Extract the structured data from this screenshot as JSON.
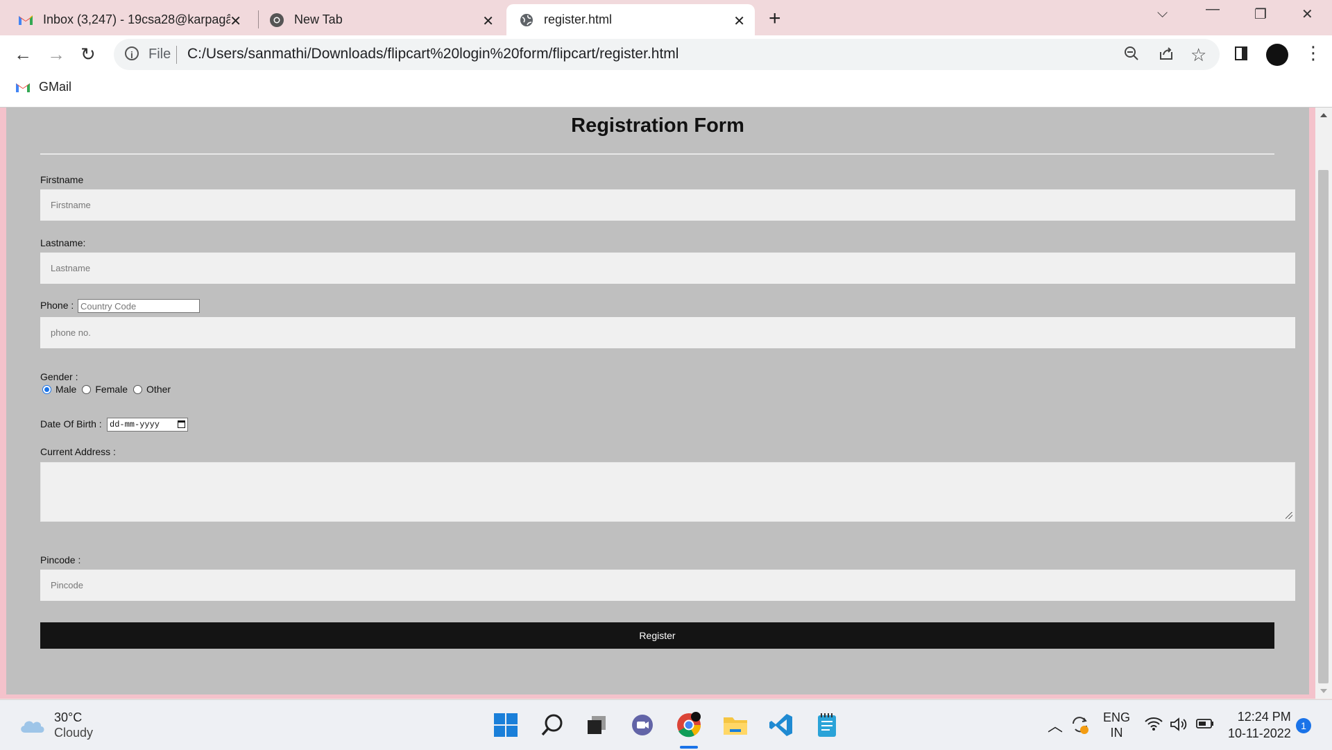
{
  "browser": {
    "tabs": [
      {
        "title": "Inbox (3,247) - 19csa28@karpagâ"
      },
      {
        "title": "New Tab"
      },
      {
        "title": "register.html"
      }
    ],
    "address_bar": {
      "scheme_label": "File",
      "url": "C:/Users/sanmathi/Downloads/flipcart%20login%20form/flipcart/register.html"
    },
    "bookmarks": [
      {
        "label": "GMail"
      }
    ]
  },
  "form": {
    "title": "Registration Form",
    "firstname": {
      "label": "Firstname",
      "placeholder": "Firstname",
      "value": ""
    },
    "lastname": {
      "label": "Lastname:",
      "placeholder": "Lastname",
      "value": ""
    },
    "phone": {
      "label": "Phone :",
      "country_code_placeholder": "Country Code",
      "placeholder": "phone no.",
      "value": ""
    },
    "gender": {
      "label": "Gender :",
      "options": [
        "Male",
        "Female",
        "Other"
      ],
      "selected": "Male"
    },
    "dob": {
      "label": "Date Of Birth :",
      "placeholder": "dd-mm-yyyy"
    },
    "address": {
      "label": "Current Address :",
      "value": ""
    },
    "pincode": {
      "label": "Pincode :",
      "placeholder": "Pincode",
      "value": ""
    },
    "submit_label": "Register"
  },
  "taskbar": {
    "weather": {
      "temp": "30°C",
      "condition": "Cloudy"
    },
    "language": {
      "line1": "ENG",
      "line2": "IN"
    },
    "clock": {
      "time": "12:24 PM",
      "date": "10-11-2022"
    },
    "notification_count": "1"
  },
  "colors": {
    "accent": "#1a73e8",
    "page_border": "#f4c2cb",
    "form_bg": "#bfbfbf",
    "button_bg": "#141414"
  }
}
